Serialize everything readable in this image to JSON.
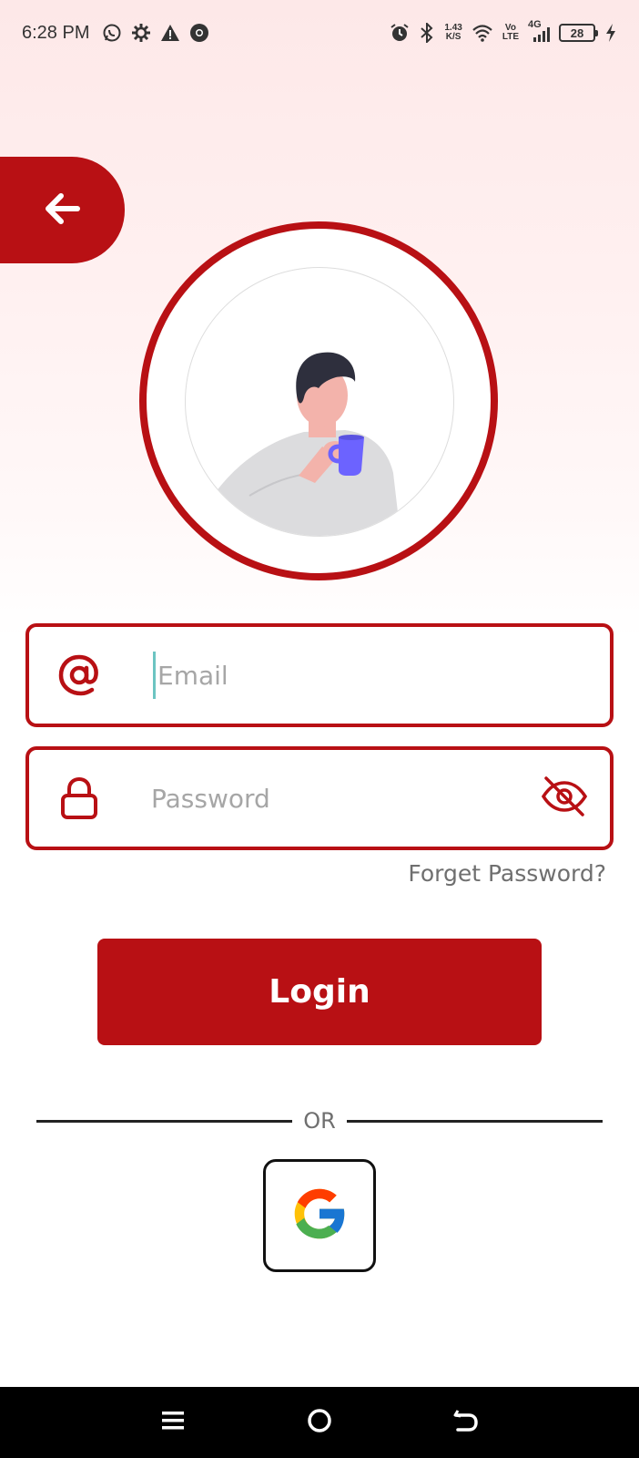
{
  "status_bar": {
    "time": "6:28 PM",
    "net_speed_value": "1.43",
    "net_speed_unit": "K/S",
    "volte_top": "Vo",
    "volte_bottom": "LTE",
    "network_type": "4G",
    "battery_level": "28",
    "left_icons": [
      "whatsapp-icon",
      "settings-icon",
      "warning-icon",
      "chrome-icon"
    ],
    "right_icons": [
      "alarm-icon",
      "bluetooth-icon",
      "wifi-icon",
      "signal-icon",
      "battery-icon",
      "charging-icon"
    ]
  },
  "header": {
    "back_icon": "arrow-left-icon"
  },
  "form": {
    "email_placeholder": "Email",
    "email_value": "",
    "password_placeholder": "Password",
    "password_value": "",
    "forget_password_label": "Forget Password?",
    "login_label": "Login",
    "or_label": "OR",
    "google_icon": "google-icon"
  },
  "colors": {
    "primary": "#b81014",
    "muted_text": "#6f6f6f",
    "placeholder": "#a6a6a6",
    "caret": "#6cc4c2"
  },
  "nav_bar": {
    "items": [
      "menu-icon",
      "home-icon",
      "back-icon"
    ]
  }
}
